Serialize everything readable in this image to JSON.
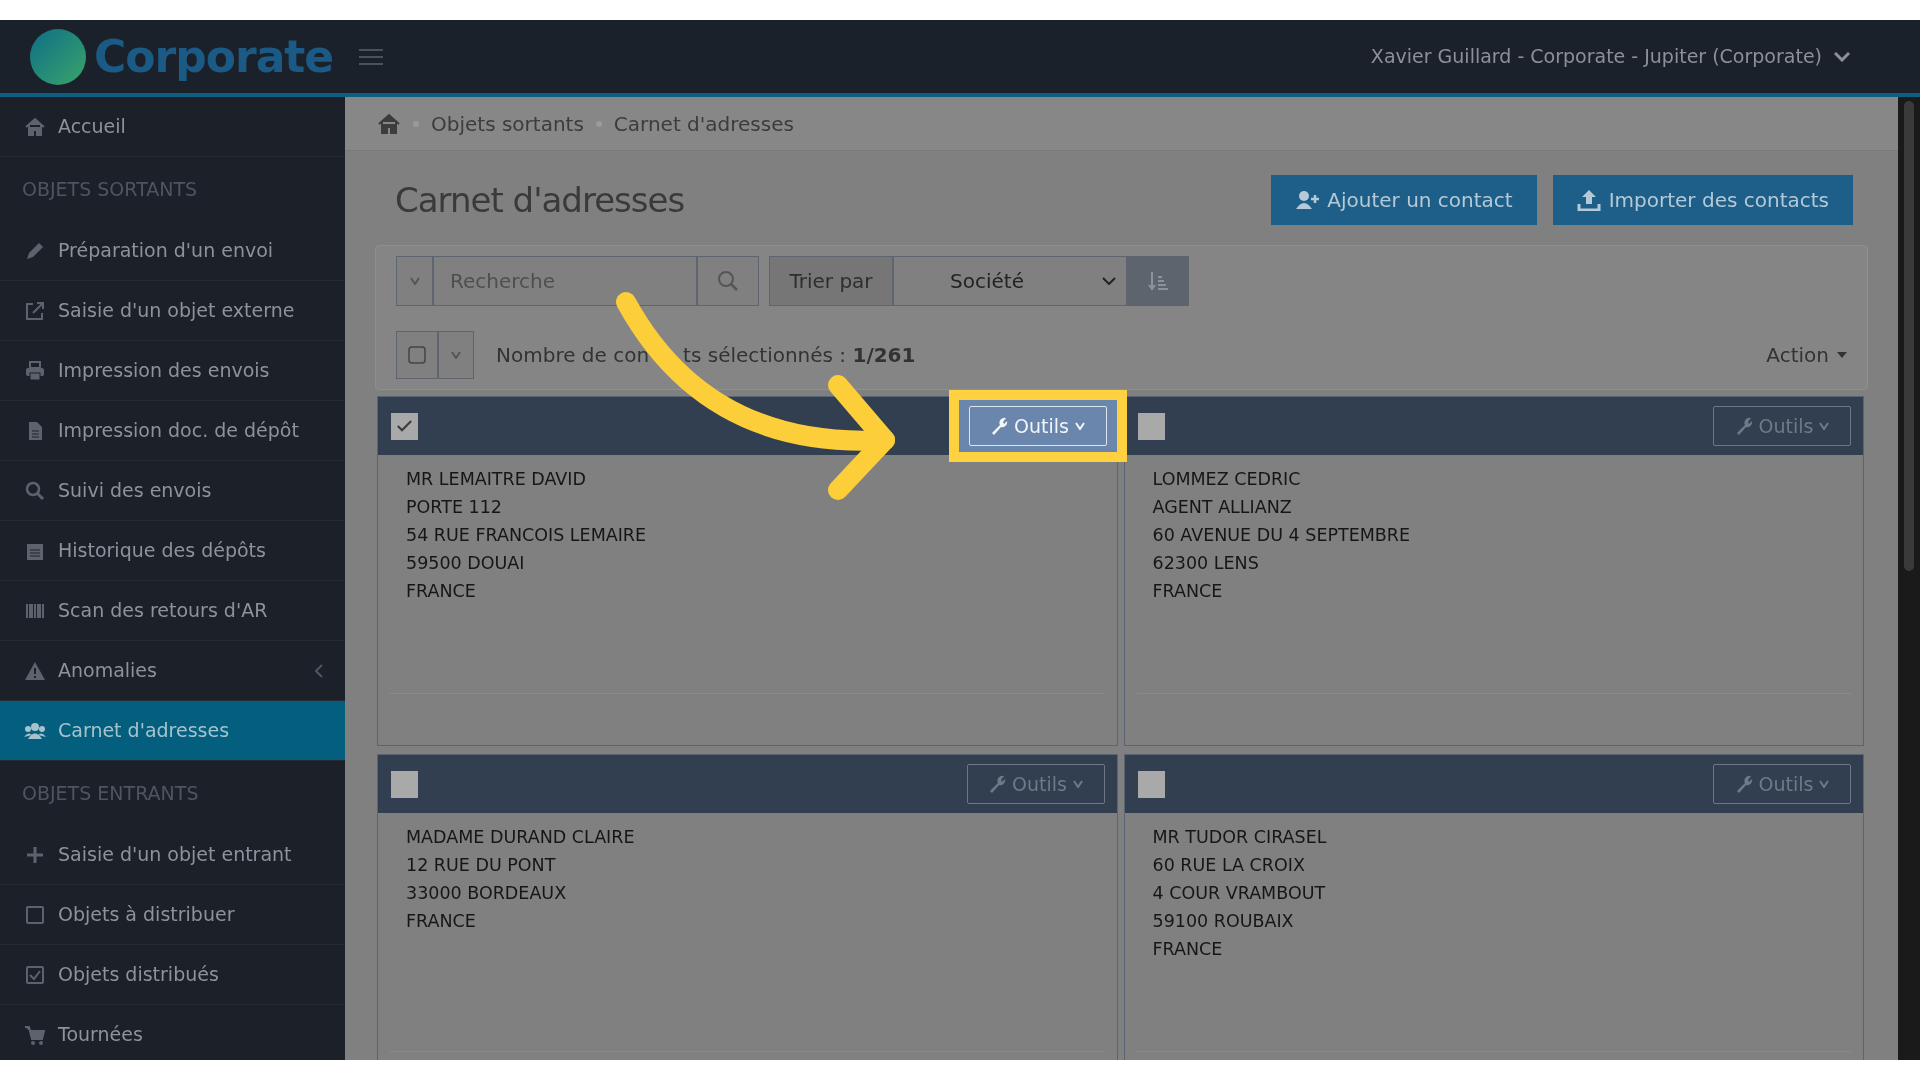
{
  "header": {
    "logo": "Corporate",
    "user": "Xavier Guillard - Corporate - Jupiter (Corporate)"
  },
  "sidebar": {
    "items": [
      {
        "kind": "link",
        "label": "Accueil",
        "selected": false,
        "expandable": false
      },
      {
        "kind": "section",
        "label": "OBJETS SORTANTS"
      },
      {
        "kind": "link",
        "label": "Préparation d'un envoi",
        "selected": false,
        "expandable": false
      },
      {
        "kind": "link",
        "label": "Saisie d'un objet externe",
        "selected": false,
        "expandable": false
      },
      {
        "kind": "link",
        "label": "Impression des envois",
        "selected": false,
        "expandable": false
      },
      {
        "kind": "link",
        "label": "Impression doc. de dépôt",
        "selected": false,
        "expandable": false
      },
      {
        "kind": "link",
        "label": "Suivi des envois",
        "selected": false,
        "expandable": false
      },
      {
        "kind": "link",
        "label": "Historique des dépôts",
        "selected": false,
        "expandable": false
      },
      {
        "kind": "link",
        "label": "Scan des retours d'AR",
        "selected": false,
        "expandable": false
      },
      {
        "kind": "link",
        "label": "Anomalies",
        "selected": false,
        "expandable": true
      },
      {
        "kind": "link",
        "label": "Carnet d'adresses",
        "selected": true,
        "expandable": false
      },
      {
        "kind": "section",
        "label": "OBJETS ENTRANTS"
      },
      {
        "kind": "link",
        "label": "Saisie d'un objet entrant",
        "selected": false,
        "expandable": false
      },
      {
        "kind": "link",
        "label": "Objets à distribuer",
        "selected": false,
        "expandable": false
      },
      {
        "kind": "link",
        "label": "Objets distribués",
        "selected": false,
        "expandable": false
      },
      {
        "kind": "link",
        "label": "Tournées",
        "selected": false,
        "expandable": false
      }
    ]
  },
  "breadcrumb": [
    "Objets sortants",
    "Carnet d'adresses"
  ],
  "page_title": "Carnet d'adresses",
  "actions": [
    "Ajouter un contact",
    "Importer des contacts"
  ],
  "toolbar": {
    "search": {
      "placeholder": "Recherche"
    },
    "sort_label": "Trier par",
    "sort_value": "Société",
    "select_all": {
      "checked": false
    },
    "selection_text": [
      "Nombre de con",
      "ts sélectionnés : **1/261**"
    ],
    "action_label": "Action"
  },
  "contacts": [
    {
      "checked": true,
      "highlighted": true,
      "tools": "Outils",
      "lines": [
        "MR LEMAITRE DAVID",
        "PORTE 112",
        "54 RUE FRANCOIS LEMAIRE",
        "59500 DOUAI",
        "FRANCE"
      ]
    },
    {
      "checked": false,
      "highlighted": false,
      "tools": "Outils",
      "lines": [
        "LOMMEZ CEDRIC",
        "AGENT ALLIANZ",
        "60 AVENUE DU 4 SEPTEMBRE",
        "62300 LENS",
        "FRANCE"
      ]
    },
    {
      "checked": false,
      "highlighted": false,
      "tools": "Outils",
      "lines": [
        "MADAME DURAND CLAIRE",
        "12 RUE DU PONT",
        "33000 BORDEAUX",
        "FRANCE"
      ]
    },
    {
      "checked": false,
      "highlighted": false,
      "tools": "Outils",
      "lines": [
        "MR TUDOR CIRASEL",
        "60 RUE LA CROIX",
        "4 COUR VRAMBOUT",
        "59100 ROUBAIX",
        "FRANCE"
      ]
    }
  ]
}
